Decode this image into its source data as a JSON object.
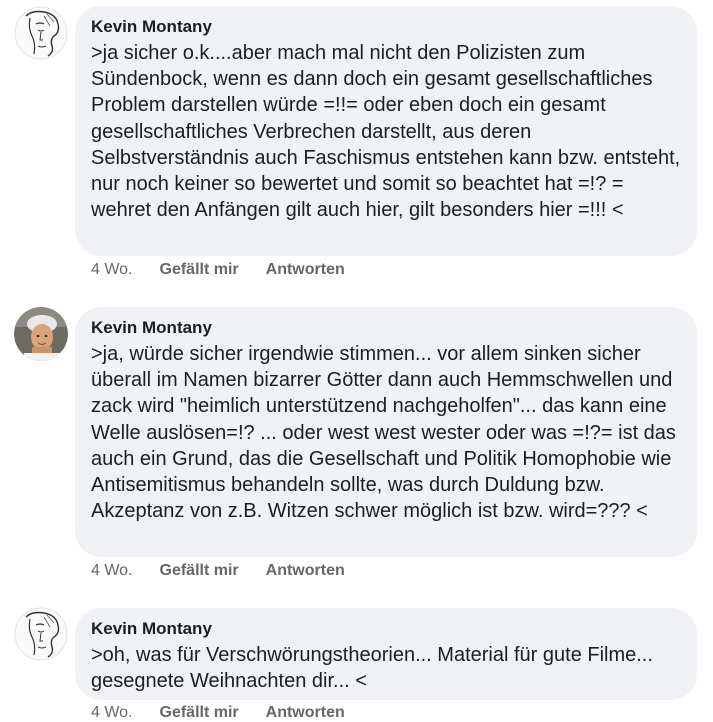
{
  "comments": [
    {
      "author": "Kevin Montany",
      "text": ">ja sicher o.k....aber mach mal nicht den Polizisten zum Sündenbock, wenn es dann doch ein gesamt gesellschaftliches Problem darstellen würde =!!= oder eben doch  ein gesamt gesellschaftliches Verbrechen darstellt, aus deren Selbstverständnis auch Faschismus entstehen kann bzw. entsteht, nur noch keiner so bewertet und somit so  beachtet hat =!? = wehret den Anfängen gilt auch hier, gilt besonders hier =!!! <",
      "time": "4 Wo.",
      "like_label": "Gefällt mir",
      "reply_label": "Antworten",
      "avatar": "sketch-face"
    },
    {
      "author": "Kevin Montany",
      "text": ">ja, würde sicher irgendwie stimmen... vor allem sinken sicher überall im Namen bizarrer Götter dann auch Hemmschwellen und zack wird \"heimlich unterstützend nachgeholfen\"... das kann eine Welle auslösen=!? ... oder west west wester oder was =!?= ist das auch ein Grund, das die Gesellschaft und Politik Homophobie wie Antisemitismus behandeln sollte, was durch Duldung bzw. Akzeptanz von z.B. Witzen schwer möglich ist bzw. wird=??? <",
      "time": "4 Wo.",
      "like_label": "Gefällt mir",
      "reply_label": "Antworten",
      "avatar": "photo-person"
    },
    {
      "author": "Kevin Montany",
      "text": ">oh, was für  Verschwörungstheorien... Material für gute Filme... gesegnete Weihnachten dir... <",
      "time": "4 Wo.",
      "like_label": "Gefällt mir",
      "reply_label": "Antworten",
      "avatar": "sketch-face"
    }
  ]
}
